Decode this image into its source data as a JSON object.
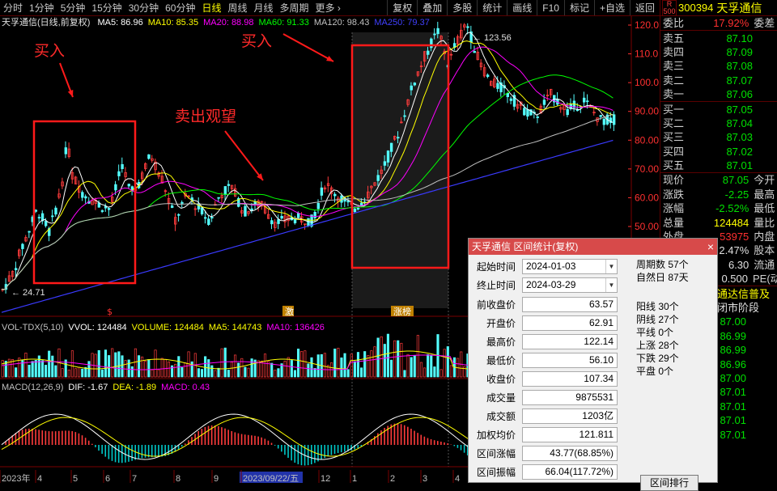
{
  "toolbar": {
    "periods": [
      "分时",
      "1分钟",
      "5分钟",
      "15分钟",
      "30分钟",
      "60分钟",
      "日线",
      "周线",
      "月线",
      "多周期",
      "更多 ›"
    ],
    "active_period": "日线",
    "right_buttons": [
      "复权",
      "叠加",
      "多股",
      "统计",
      "画线",
      "F10",
      "标记",
      "+自选",
      "返回"
    ]
  },
  "chart": {
    "title": "天孚通信(日线,前复权)",
    "ma_legend": [
      {
        "label": "MA5: 86.96",
        "color": "#ffffff"
      },
      {
        "label": "MA10: 85.35",
        "color": "#ffff00"
      },
      {
        "label": "MA20: 88.98",
        "color": "#ff00ff"
      },
      {
        "label": "MA60: 91.33",
        "color": "#00ff00"
      },
      {
        "label": "MA120: 98.43",
        "color": "#c0c0c0"
      },
      {
        "label": "MA250: 79.37",
        "color": "#4040ff"
      }
    ],
    "price_axis": [
      "120.0",
      "110.0",
      "100.0",
      "90.00",
      "80.00",
      "70.00",
      "60.00",
      "50.00"
    ],
    "high_label": "123.56",
    "low_label": "24.71",
    "markers": [
      "$",
      "激",
      "涨榜"
    ],
    "vol_legend": [
      {
        "label": "VOL-TDX(5,10)",
        "color": "#c0c0c0"
      },
      {
        "label": "VVOL: 124484",
        "color": "#ffffff"
      },
      {
        "label": "VOLUME: 124484",
        "color": "#ffff00"
      },
      {
        "label": "MA5: 144743",
        "color": "#ffff00"
      },
      {
        "label": "MA10: 136426",
        "color": "#ff00ff"
      }
    ],
    "macd_legend": [
      {
        "label": "MACD(12,26,9)",
        "color": "#c0c0c0"
      },
      {
        "label": "DIF: -1.67",
        "color": "#ffffff"
      },
      {
        "label": "DEA: -1.89",
        "color": "#ffff00"
      },
      {
        "label": "MACD: 0.43",
        "color": "#ff00ff"
      }
    ],
    "date_axis": [
      "2023年",
      "4",
      "5",
      "6",
      "7",
      "8",
      "9",
      "2023/09/22/五",
      "12",
      "1",
      "2",
      "3",
      "4"
    ]
  },
  "annotations": {
    "buy1": "买入",
    "buy2": "买入",
    "sell": "卖出观望"
  },
  "quote": {
    "code": "300394",
    "name": "天孚通信",
    "badge": "R 500",
    "webi_label": "委比",
    "webi_value": "17.92%",
    "webi_extra": "委差",
    "asks": [
      {
        "label": "卖五",
        "price": "87.10"
      },
      {
        "label": "卖四",
        "price": "87.09"
      },
      {
        "label": "卖三",
        "price": "87.08"
      },
      {
        "label": "卖二",
        "price": "87.07"
      },
      {
        "label": "卖一",
        "price": "87.06"
      }
    ],
    "bids": [
      {
        "label": "买一",
        "price": "87.05"
      },
      {
        "label": "买二",
        "price": "87.04"
      },
      {
        "label": "买三",
        "price": "87.03"
      },
      {
        "label": "买四",
        "price": "87.02"
      },
      {
        "label": "买五",
        "price": "87.01"
      }
    ],
    "stats": [
      {
        "label": "现价",
        "value": "87.05",
        "extra": "今开",
        "cls": "green"
      },
      {
        "label": "涨跌",
        "value": "-2.25",
        "extra": "最高",
        "cls": "green"
      },
      {
        "label": "涨幅",
        "value": "-2.52%",
        "extra": "最低",
        "cls": "green"
      },
      {
        "label": "总量",
        "value": "124484",
        "extra": "量比",
        "cls": "yellow"
      },
      {
        "label": "外盘",
        "value": "53975",
        "extra": "内盘",
        "cls": "red"
      },
      {
        "label": "换手",
        "value": "2.47%",
        "extra": "股本",
        "cls": "white"
      },
      {
        "label": "净资",
        "value": "6.30",
        "extra": "流通",
        "cls": "white"
      },
      {
        "label": "收益",
        "value": "0.500",
        "extra": "PE(动)",
        "cls": "white"
      }
    ],
    "notice1": "通达信普及",
    "notice2": "闭市阶段",
    "ticks": [
      "87.00",
      "86.99",
      "86.99",
      "86.96",
      "87.00",
      "87.01",
      "87.01",
      "87.01",
      "87.01"
    ]
  },
  "dialog": {
    "title": "天孚通信 区间统计(复权)",
    "close": "×",
    "start_label": "起始时间",
    "start_value": "2024-01-03",
    "end_label": "终止时间",
    "end_value": "2024-03-29",
    "rows": [
      {
        "label": "前收盘价",
        "value": "63.57"
      },
      {
        "label": "开盘价",
        "value": "62.91"
      },
      {
        "label": "最高价",
        "value": "122.14"
      },
      {
        "label": "最低价",
        "value": "56.10"
      },
      {
        "label": "收盘价",
        "value": "107.34"
      },
      {
        "label": "成交量",
        "value": "9875531"
      },
      {
        "label": "成交额",
        "value": "1203亿"
      },
      {
        "label": "加权均价",
        "value": "121.811"
      },
      {
        "label": "区间涨幅",
        "value": "43.77(68.85%)"
      },
      {
        "label": "区间振幅",
        "value": "66.04(117.72%)"
      }
    ],
    "stats1": [
      "周期数 57个",
      "自然日 87天"
    ],
    "stats2": [
      "阳线 30个",
      "阴线 27个",
      "平线 0个",
      "上涨 28个",
      "下跌 29个",
      "平盘 0个"
    ],
    "button": "区间排行"
  }
}
